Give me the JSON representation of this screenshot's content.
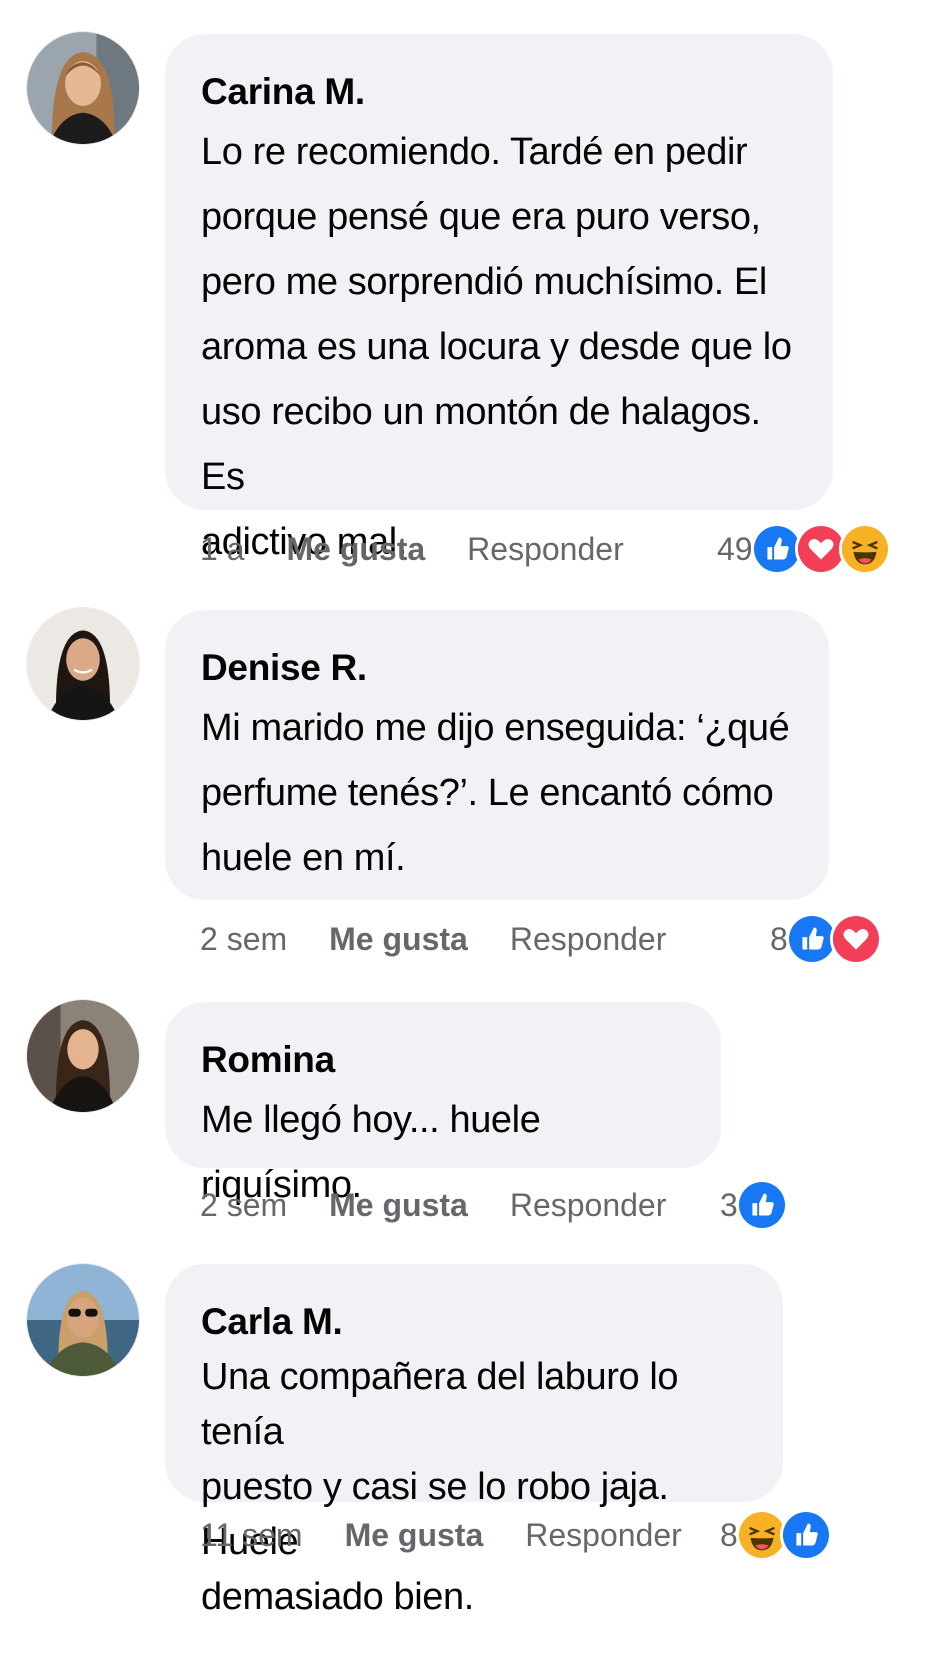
{
  "comments": [
    {
      "author": "Carina M.",
      "text": "Lo re recomiendo. Tardé en pedir\nporque pensé que era puro verso,\npero me sorprendió muchísimo. El\naroma es una locura y desde que lo\nuso recibo un montón de halagos. Es\nadictivo mal.",
      "time": "1 a",
      "like_label": "Me gusta",
      "reply_label": "Responder",
      "reaction_count": "49",
      "reactions": [
        "like-icon",
        "love-icon",
        "haha-icon"
      ]
    },
    {
      "author": "Denise R.",
      "text": "Mi marido me dijo enseguida: ‘¿qué\nperfume tenés?’. Le encantó cómo\nhuele en mí.",
      "time": "2 sem",
      "like_label": "Me gusta",
      "reply_label": "Responder",
      "reaction_count": "8",
      "reactions": [
        "like-icon",
        "love-icon"
      ]
    },
    {
      "author": "Romina",
      "text": "Me llegó hoy... huele riquísimo.",
      "time": "2 sem",
      "like_label": "Me gusta",
      "reply_label": "Responder",
      "reaction_count": "3",
      "reactions": [
        "like-icon"
      ]
    },
    {
      "author": "Carla M.",
      "text": "Una compañera del laburo lo tenía\npuesto y casi se lo robo jaja. Huele\ndemasiado bien.",
      "time": "11 sem",
      "like_label": "Me gusta",
      "reply_label": "Responder",
      "reaction_count": "8",
      "reactions": [
        "haha-icon",
        "like-icon"
      ]
    }
  ],
  "colors": {
    "bubble": "#f0f2f5",
    "like": "#1877f2",
    "love": "#f33e58",
    "haha": "#f7b125",
    "meta_text": "#65676b"
  }
}
